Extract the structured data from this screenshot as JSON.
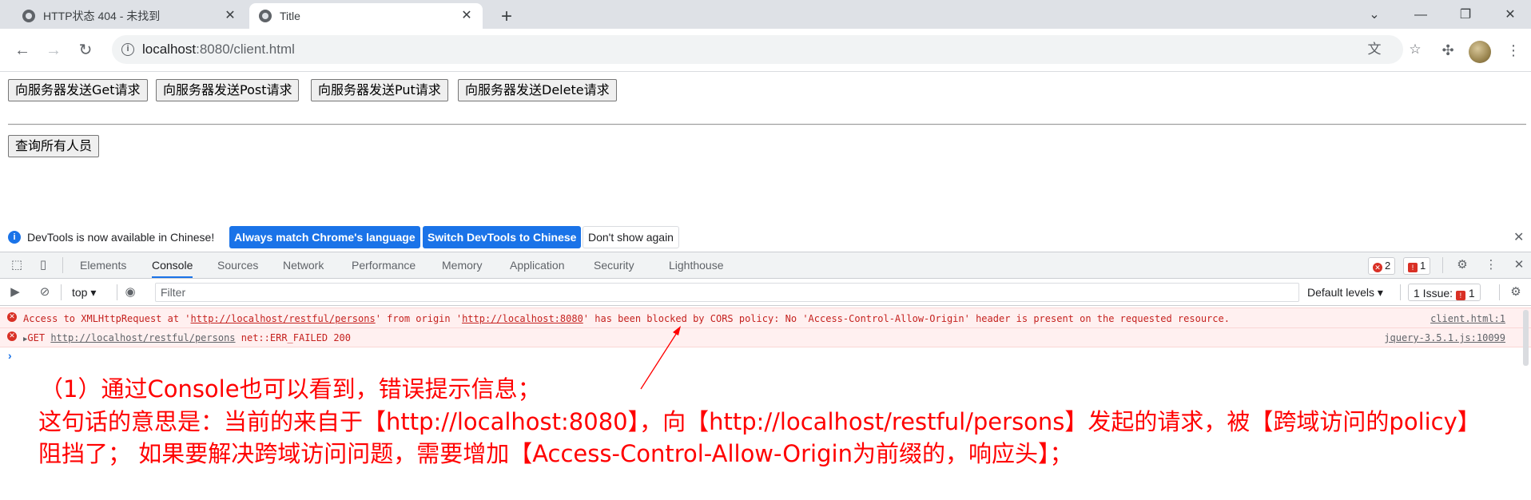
{
  "browser": {
    "tabs": [
      {
        "title": "HTTP状态 404 - 未找到",
        "active": false
      },
      {
        "title": "Title",
        "active": true
      }
    ],
    "new_tab_icon": "plus-icon",
    "window_controls": {
      "dropdown": "⌄",
      "minimize": "—",
      "restore": "❐",
      "close": "✕"
    },
    "url_host": "localhost",
    "url_path": ":8080/client.html"
  },
  "page": {
    "buttons": [
      "向服务器发送Get请求",
      "向服务器发送Post请求",
      "向服务器发送Put请求",
      "向服务器发送Delete请求"
    ],
    "query_button": "查询所有人员"
  },
  "infobar": {
    "message": "DevTools is now available in Chinese!",
    "btn_match": "Always match Chrome's language",
    "btn_switch": "Switch DevTools to Chinese",
    "btn_dont_show": "Don't show again"
  },
  "devtools": {
    "tabs": [
      "Elements",
      "Console",
      "Sources",
      "Network",
      "Performance",
      "Memory",
      "Application",
      "Security",
      "Lighthouse"
    ],
    "active_tab": "Console",
    "error_count": "2",
    "issue_count": "1",
    "context": "top",
    "filter_placeholder": "Filter",
    "levels": "Default levels",
    "issues_label": "1 Issue:",
    "issues_badge": "1"
  },
  "console": {
    "rows": [
      {
        "pre": "Access to XMLHttpRequest at '",
        "link1": "http://localhost/restful/persons",
        "mid": "' from origin '",
        "link2": "http://localhost:8080",
        "post": "' has been blocked by CORS policy: No 'Access-Control-Allow-Origin' header is present on the requested resource.",
        "source": "client.html:1"
      },
      {
        "pre": "GET ",
        "link1": "http://localhost/restful/persons",
        "post": " net::ERR_FAILED 200",
        "source": "jquery-3.5.1.js:10099"
      }
    ]
  },
  "annotation": {
    "line1": "（1）通过Console也可以看到，错误提示信息；",
    "line2": "这句话的意思是：当前的来自于【http://localhost:8080】，向【http://localhost/restful/persons】发起的请求，被【跨域访问的policy】",
    "line3": "阻挡了；   如果要解决跨域访问问题，需要增加【Access-Control-Allow-Origin为前缀的，响应头】；"
  }
}
